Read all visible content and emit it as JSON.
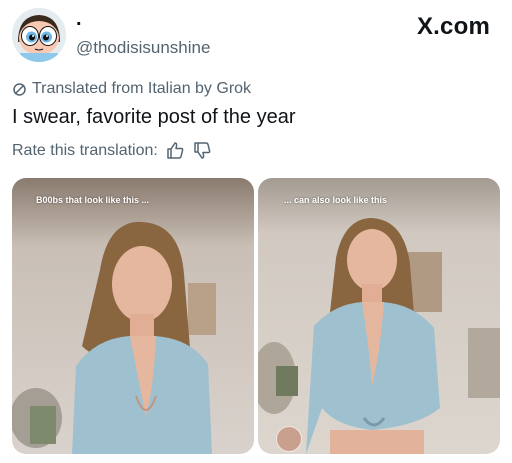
{
  "post": {
    "display_name": ".",
    "handle": "@thodisisunshine",
    "site": "X.com",
    "translated_label": "Translated from Italian by Grok",
    "text": "I swear, favorite post of the year",
    "rate_label": "Rate this translation:"
  },
  "media": {
    "left_caption": "B00bs that look like this ...",
    "right_caption": "... can also look like this"
  },
  "icons": [
    "avatar-powerpuff",
    "translate-icon",
    "thumbs-up-icon",
    "thumbs-down-icon"
  ]
}
